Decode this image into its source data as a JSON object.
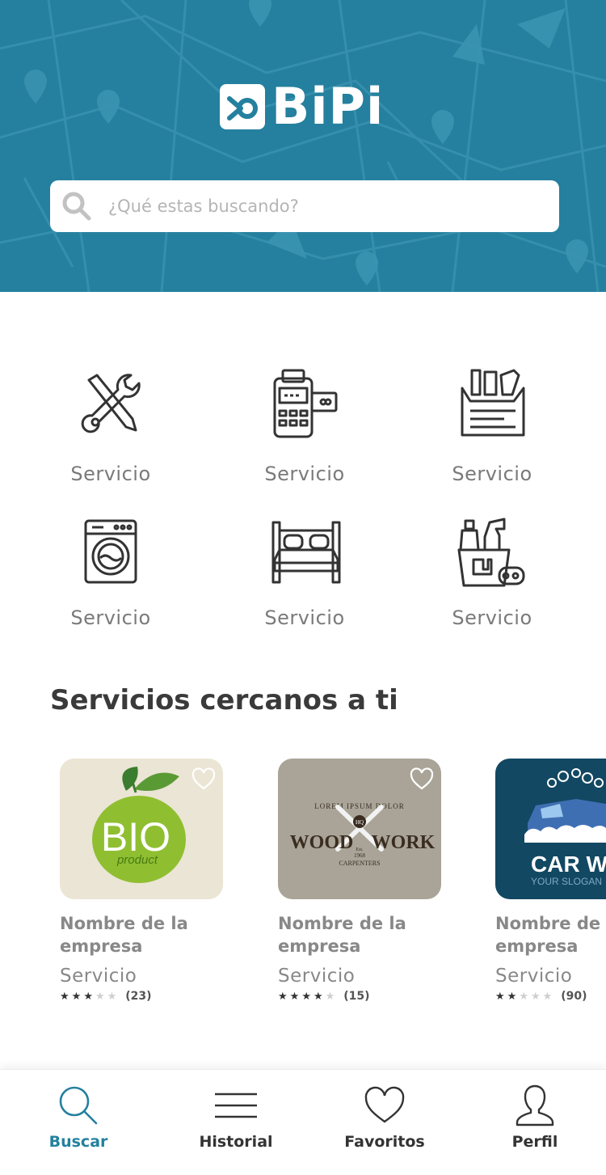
{
  "brand": {
    "name": "BiPi",
    "colors": {
      "primary": "#24809e",
      "text": "#333333",
      "muted": "#888888"
    }
  },
  "search": {
    "placeholder": "¿Qué estas buscando?"
  },
  "categories": [
    {
      "label": "Servicio",
      "icon": "tools-icon"
    },
    {
      "label": "Servicio",
      "icon": "payment-terminal-icon"
    },
    {
      "label": "Servicio",
      "icon": "toolbox-icon"
    },
    {
      "label": "Servicio",
      "icon": "washing-machine-icon"
    },
    {
      "label": "Servicio",
      "icon": "bed-icon"
    },
    {
      "label": "Servicio",
      "icon": "cleaning-supplies-icon"
    }
  ],
  "nearby": {
    "title": "Servicios cercanos a ti",
    "cards": [
      {
        "name": "Nombre de la empresa",
        "service": "Servicio",
        "rating": 3,
        "count": "(23)",
        "logo": {
          "main": "BIO",
          "sub": "product"
        }
      },
      {
        "name": "Nombre de la empresa",
        "service": "Servicio",
        "rating": 4,
        "count": "(15)",
        "logo": {
          "top": "LOREM IPSUM DOLOR",
          "left": "WOOD",
          "right": "WORK",
          "badge": "HQ",
          "est": "Est.",
          "year": "1968",
          "bottom": "CARPENTERS"
        }
      },
      {
        "name": "Nombre de la empresa",
        "service": "Servicio",
        "rating": 2,
        "count": "(90)",
        "logo": {
          "main": "CAR WA",
          "sub": "YOUR SLOGAN"
        }
      }
    ]
  },
  "nav": [
    {
      "label": "Buscar",
      "icon": "search-icon",
      "active": true
    },
    {
      "label": "Historial",
      "icon": "menu-icon",
      "active": false
    },
    {
      "label": "Favoritos",
      "icon": "heart-icon",
      "active": false
    },
    {
      "label": "Perfil",
      "icon": "user-icon",
      "active": false
    }
  ]
}
